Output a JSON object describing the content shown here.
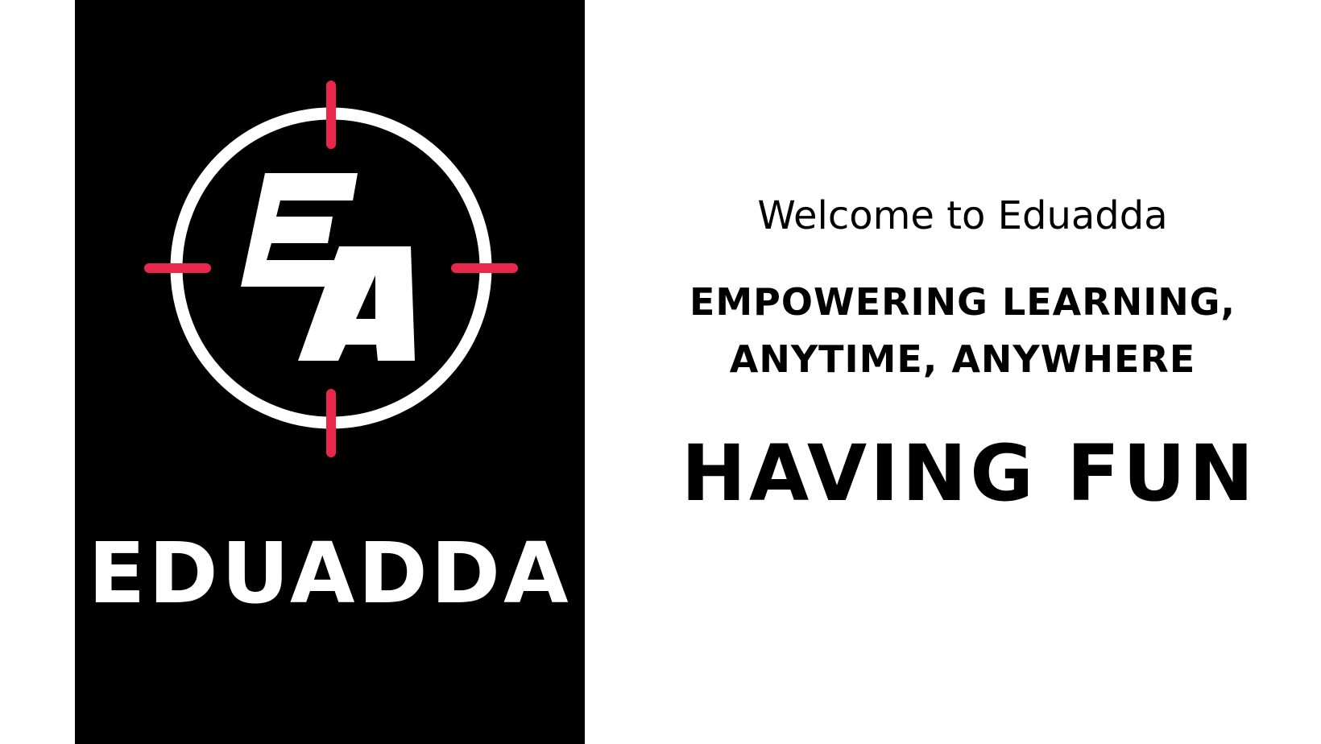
{
  "logo": {
    "monogram": "EA",
    "brand_name": "EDUADDA",
    "ring_color": "#ffffff",
    "crosshair_color": "#e8274b",
    "panel_color": "#000000"
  },
  "content": {
    "welcome": "Welcome to Eduadda",
    "tagline_line1": "EMPOWERING LEARNING,",
    "tagline_line2": "ANYTIME, ANYWHERE",
    "headline": "HAVING FUN"
  }
}
